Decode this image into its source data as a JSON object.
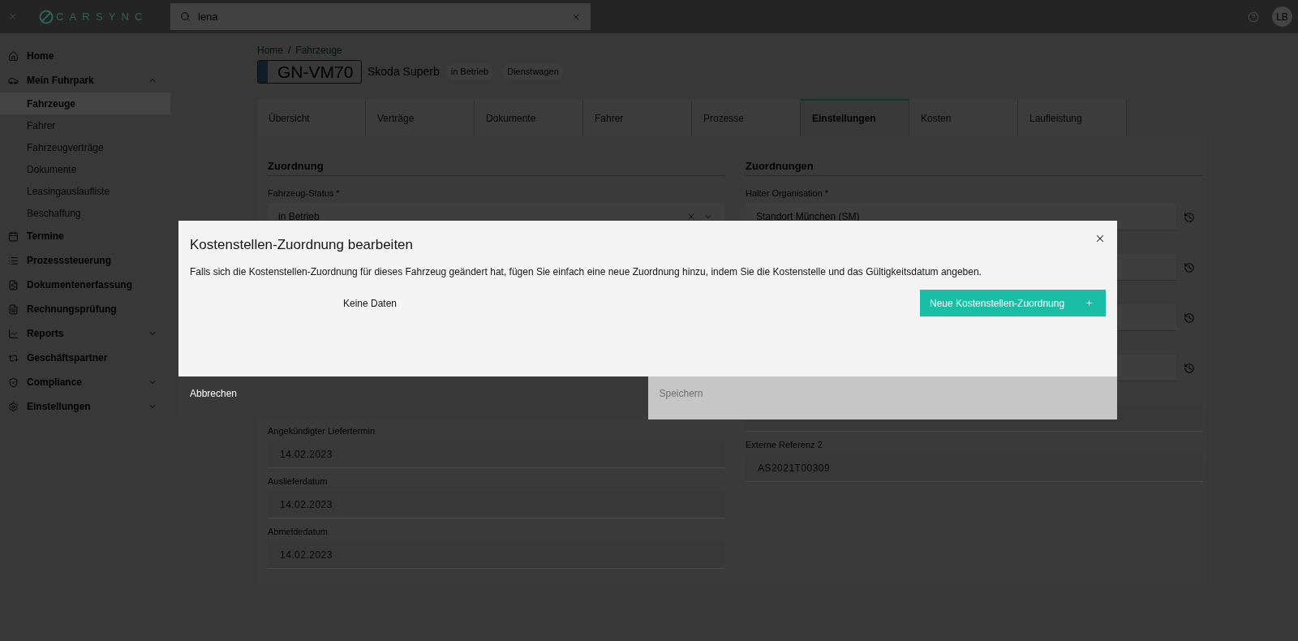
{
  "topbar": {
    "logo": "CARSYNC",
    "search": {
      "value": "lena"
    },
    "avatar": "LB"
  },
  "sidebar": {
    "items": [
      {
        "label": "Home",
        "kind": "link",
        "selected": false
      },
      {
        "label": "Mein Fuhrpark",
        "kind": "group",
        "expanded": true,
        "selected": false,
        "children": [
          {
            "label": "Fahrzeuge",
            "selected": true
          },
          {
            "label": "Fahrer",
            "selected": false
          },
          {
            "label": "Fahrzeugverträge",
            "selected": false
          },
          {
            "label": "Dokumente",
            "selected": false
          },
          {
            "label": "Leasingauslaufliste",
            "selected": false
          },
          {
            "label": "Beschaffung",
            "selected": false
          }
        ]
      },
      {
        "label": "Termine",
        "kind": "link",
        "selected": false
      },
      {
        "label": "Prozesssteuerung",
        "kind": "link",
        "selected": false
      },
      {
        "label": "Dokumentenerfassung",
        "kind": "link",
        "selected": false
      },
      {
        "label": "Rechnungsprüfung",
        "kind": "link",
        "selected": false
      },
      {
        "label": "Reports",
        "kind": "group",
        "expanded": false,
        "selected": false
      },
      {
        "label": "Geschäftspartner",
        "kind": "link",
        "selected": false
      },
      {
        "label": "Compliance",
        "kind": "group",
        "expanded": false,
        "selected": false
      },
      {
        "label": "Einstellungen",
        "kind": "group",
        "expanded": false,
        "selected": false
      }
    ]
  },
  "breadcrumb": {
    "items": [
      "Home",
      "Fahrzeuge"
    ],
    "separator": "/"
  },
  "vehicle": {
    "plate": "GN-VM70",
    "model": "Skoda Superb",
    "tags": [
      "in Betrieb",
      "Dienstwagen"
    ]
  },
  "tabs": [
    {
      "label": "Übersicht",
      "selected": false
    },
    {
      "label": "Verträge",
      "selected": false
    },
    {
      "label": "Dokumente",
      "selected": false
    },
    {
      "label": "Fahrer",
      "selected": false
    },
    {
      "label": "Prozesse",
      "selected": false
    },
    {
      "label": "Einstellungen",
      "selected": true
    },
    {
      "label": "Kosten",
      "selected": false
    },
    {
      "label": "Laufleistung",
      "selected": false
    }
  ],
  "sections": [
    {
      "title": "Zuordnung",
      "fields": [
        {
          "label": "Fahrzeug-Status *",
          "value": "in Betrieb",
          "kind": "select",
          "disabled": false
        },
        {
          "label": "Angekündigter Liefertermin",
          "value": "14.02.2023",
          "kind": "text",
          "disabled": true
        },
        {
          "label": "Auslieferdatum",
          "value": "14.02.2023",
          "kind": "text",
          "disabled": true
        },
        {
          "label": "Abmeldedatum",
          "value": "14.02.2023",
          "kind": "text",
          "disabled": true
        }
      ]
    },
    {
      "title": "Zuordnungen",
      "fields": [
        {
          "label": "Halter Organisation *",
          "value": "Standort München (SM)",
          "kind": "history",
          "disabled": false
        },
        {
          "kind": "history",
          "disabled": false
        },
        {
          "kind": "history",
          "disabled": false
        },
        {
          "kind": "history",
          "disabled": false
        },
        {
          "kind": "text",
          "disabled": true
        },
        {
          "label": "Externe Referenz 2",
          "value": "AS2021T00309",
          "kind": "text",
          "disabled": true
        }
      ]
    }
  ],
  "modal": {
    "title": "Kostenstellen-Zuordnung bearbeiten",
    "description": "Falls sich die Kostenstellen-Zuordnung für dieses Fahrzeug geändert hat, fügen Sie einfach eine neue Zuordnung hinzu, indem Sie die Kostenstelle und das Gültigkeitsdatum angeben.",
    "empty_text": "Keine Daten",
    "add_button": "Neue Kostenstellen-Zuordnung",
    "footer_buttons": [
      {
        "label": "Abbrechen",
        "kind": "secondary",
        "disabled": false
      },
      {
        "label": "Speichern",
        "kind": "primary",
        "disabled": true
      }
    ]
  }
}
